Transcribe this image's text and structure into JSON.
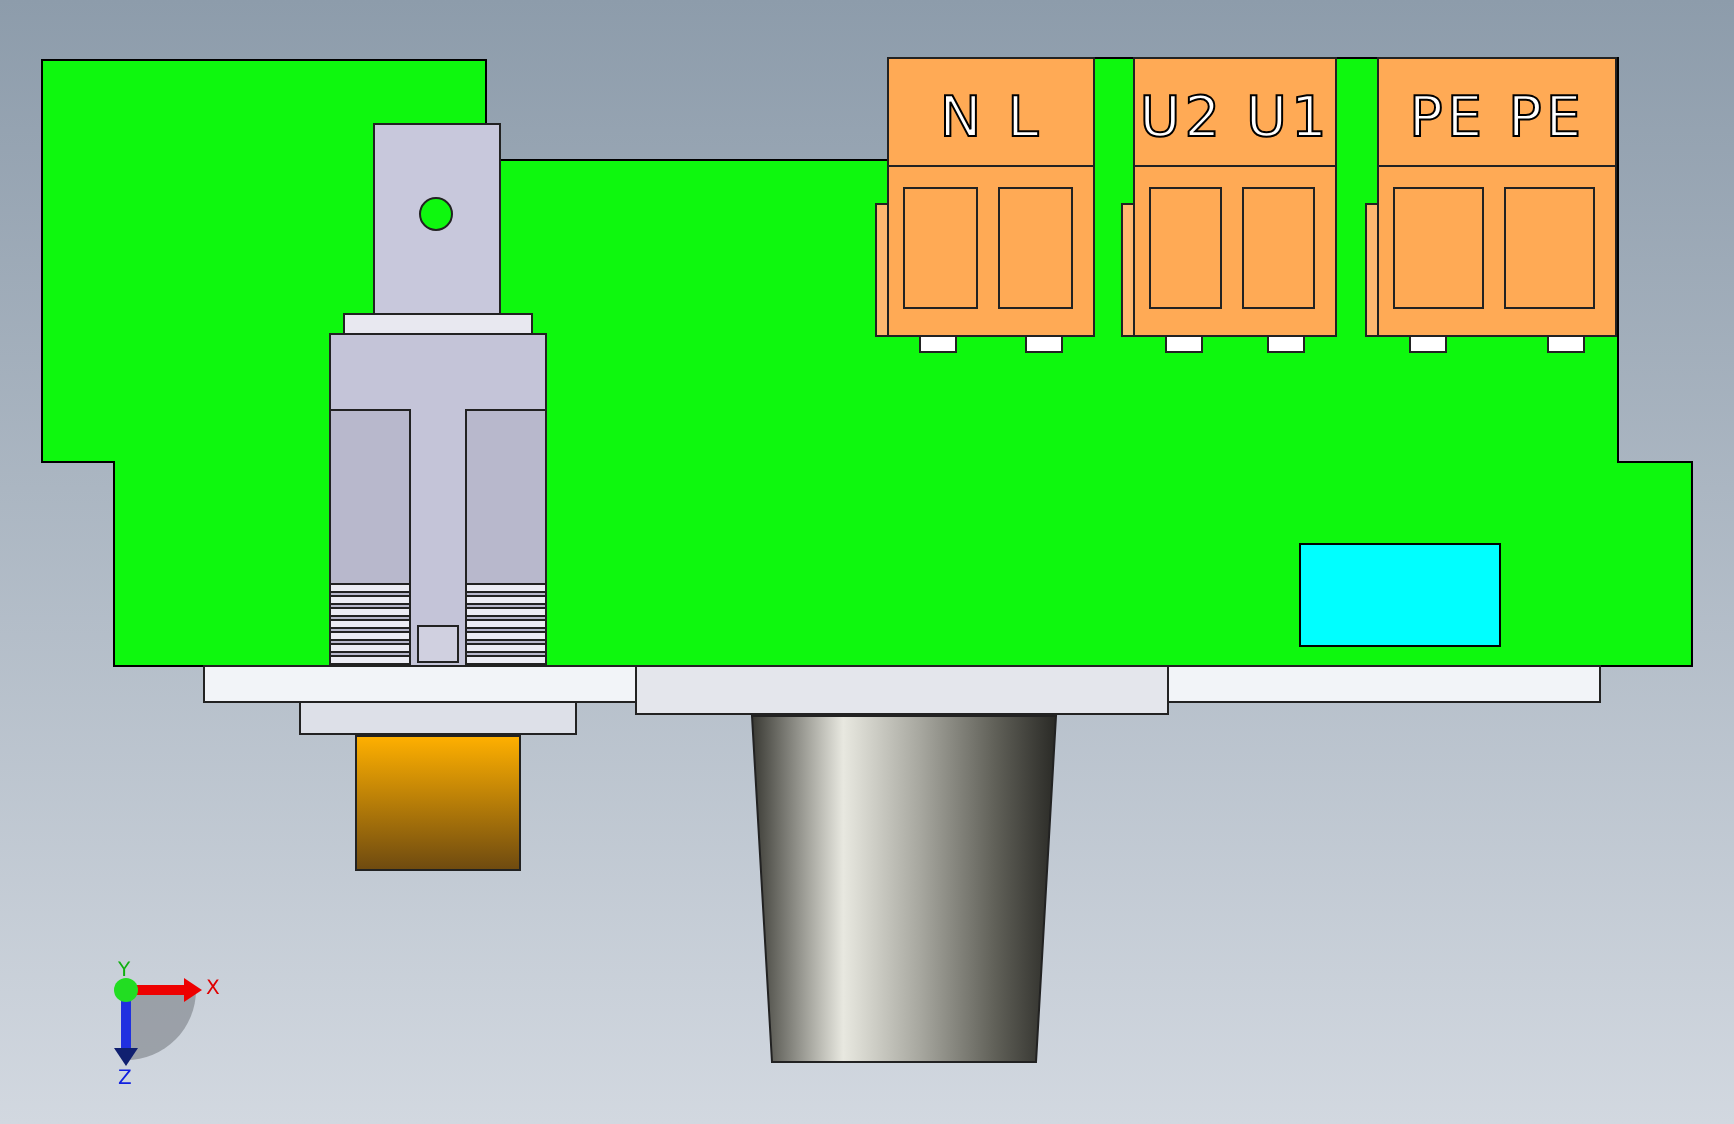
{
  "terminals": [
    {
      "label": "N L"
    },
    {
      "label": "U2 U1"
    },
    {
      "label": "PE PE"
    }
  ],
  "triad": {
    "x": "X",
    "y": "Y",
    "z": "Z"
  }
}
